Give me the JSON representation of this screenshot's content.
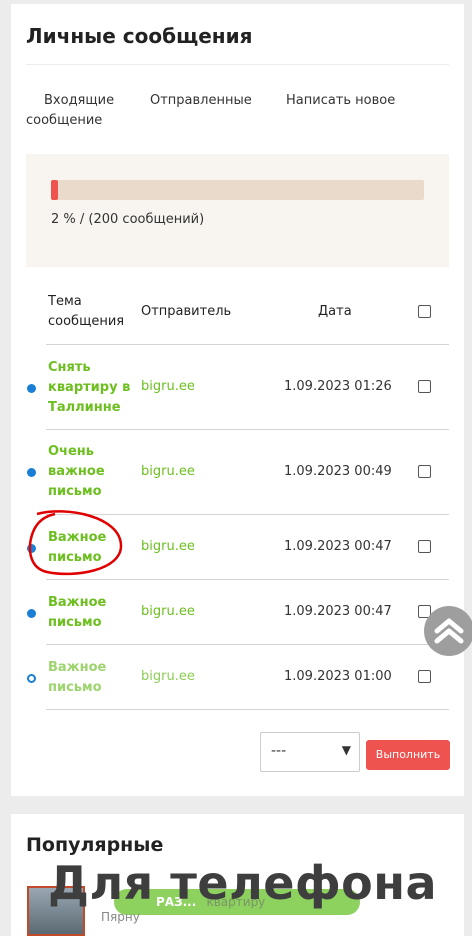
{
  "messages_title": "Личные сообщения",
  "tabs": {
    "inbox": "Входящие сообщение",
    "sent": "Отправленные",
    "compose": "Написать новое"
  },
  "quota": {
    "percent": 2,
    "text": "2 % / (200 сообщений)",
    "fill_color": "#ef5350"
  },
  "table": {
    "headers": {
      "subject": "Тема сообщения",
      "sender": "Отправитель",
      "date": "Дата"
    },
    "rows": [
      {
        "subject": "Снять квартиру в Таллинне",
        "sender": "bigru.ee",
        "date": "1.09.2023 01:26",
        "unread": true
      },
      {
        "subject": "Очень важное письмо",
        "sender": "bigru.ee",
        "date": "1.09.2023 00:49",
        "unread": true
      },
      {
        "subject": "Важное письмо",
        "sender": "bigru.ee",
        "date": "1.09.2023 00:47",
        "unread": true
      },
      {
        "subject": "Важное письмо",
        "sender": "bigru.ee",
        "date": "1.09.2023 00:47",
        "unread": true
      },
      {
        "subject": "Важное письмо",
        "sender": "bigru.ee",
        "date": "1.09.2023 01:00",
        "unread": false
      }
    ]
  },
  "actions": {
    "select_value": "---",
    "run_label": "Выполнить"
  },
  "popular": {
    "title": "Популярные",
    "item_button": "РАЗ...",
    "item_button_suffix": "квартиру",
    "item_location": "Пярну"
  },
  "overlay_text": "Для телефона",
  "colors": {
    "accent_green": "#6cbf1f",
    "danger_red": "#ef5350",
    "dot_blue": "#1a7fd4"
  }
}
